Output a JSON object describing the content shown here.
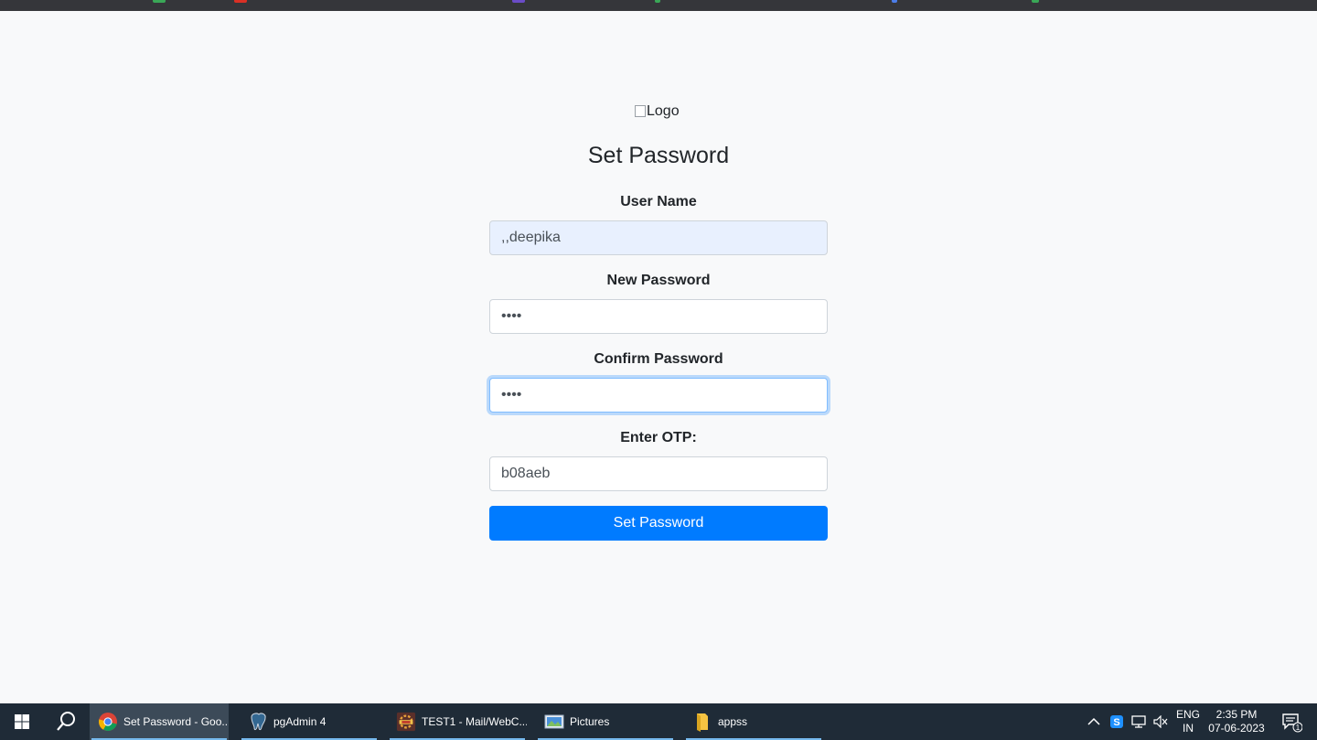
{
  "form": {
    "logo_alt": "Logo",
    "title": "Set Password",
    "username_label": "User Name",
    "username_value": ",,deepika",
    "new_password_label": "New Password",
    "new_password_value": "1234",
    "confirm_password_label": "Confirm Password",
    "confirm_password_value": "1234",
    "otp_label": "Enter OTP:",
    "otp_value": "b08aeb",
    "submit_label": "Set Password"
  },
  "taskbar": {
    "apps": [
      {
        "label": "Set Password - Goo...",
        "icon": "chrome-icon",
        "active": true
      },
      {
        "label": "pgAdmin 4",
        "icon": "pgadmin-icon",
        "active": false
      },
      {
        "label": "TEST1 - Mail/WebC...",
        "icon": "ide-icon",
        "active": false
      },
      {
        "label": "Pictures",
        "icon": "pictures-folder-icon",
        "active": false
      },
      {
        "label": "appss",
        "icon": "folder-icon",
        "active": false
      }
    ],
    "tray": {
      "lang_top": "ENG",
      "lang_bottom": "IN",
      "time": "2:35 PM",
      "date": "07-06-2023",
      "notification_count": "1"
    }
  },
  "colors": {
    "page_bg": "#f8f9fa",
    "primary": "#007bff",
    "taskbar_bg": "#1f2b37",
    "autofill_bg": "#e8f0fe"
  }
}
